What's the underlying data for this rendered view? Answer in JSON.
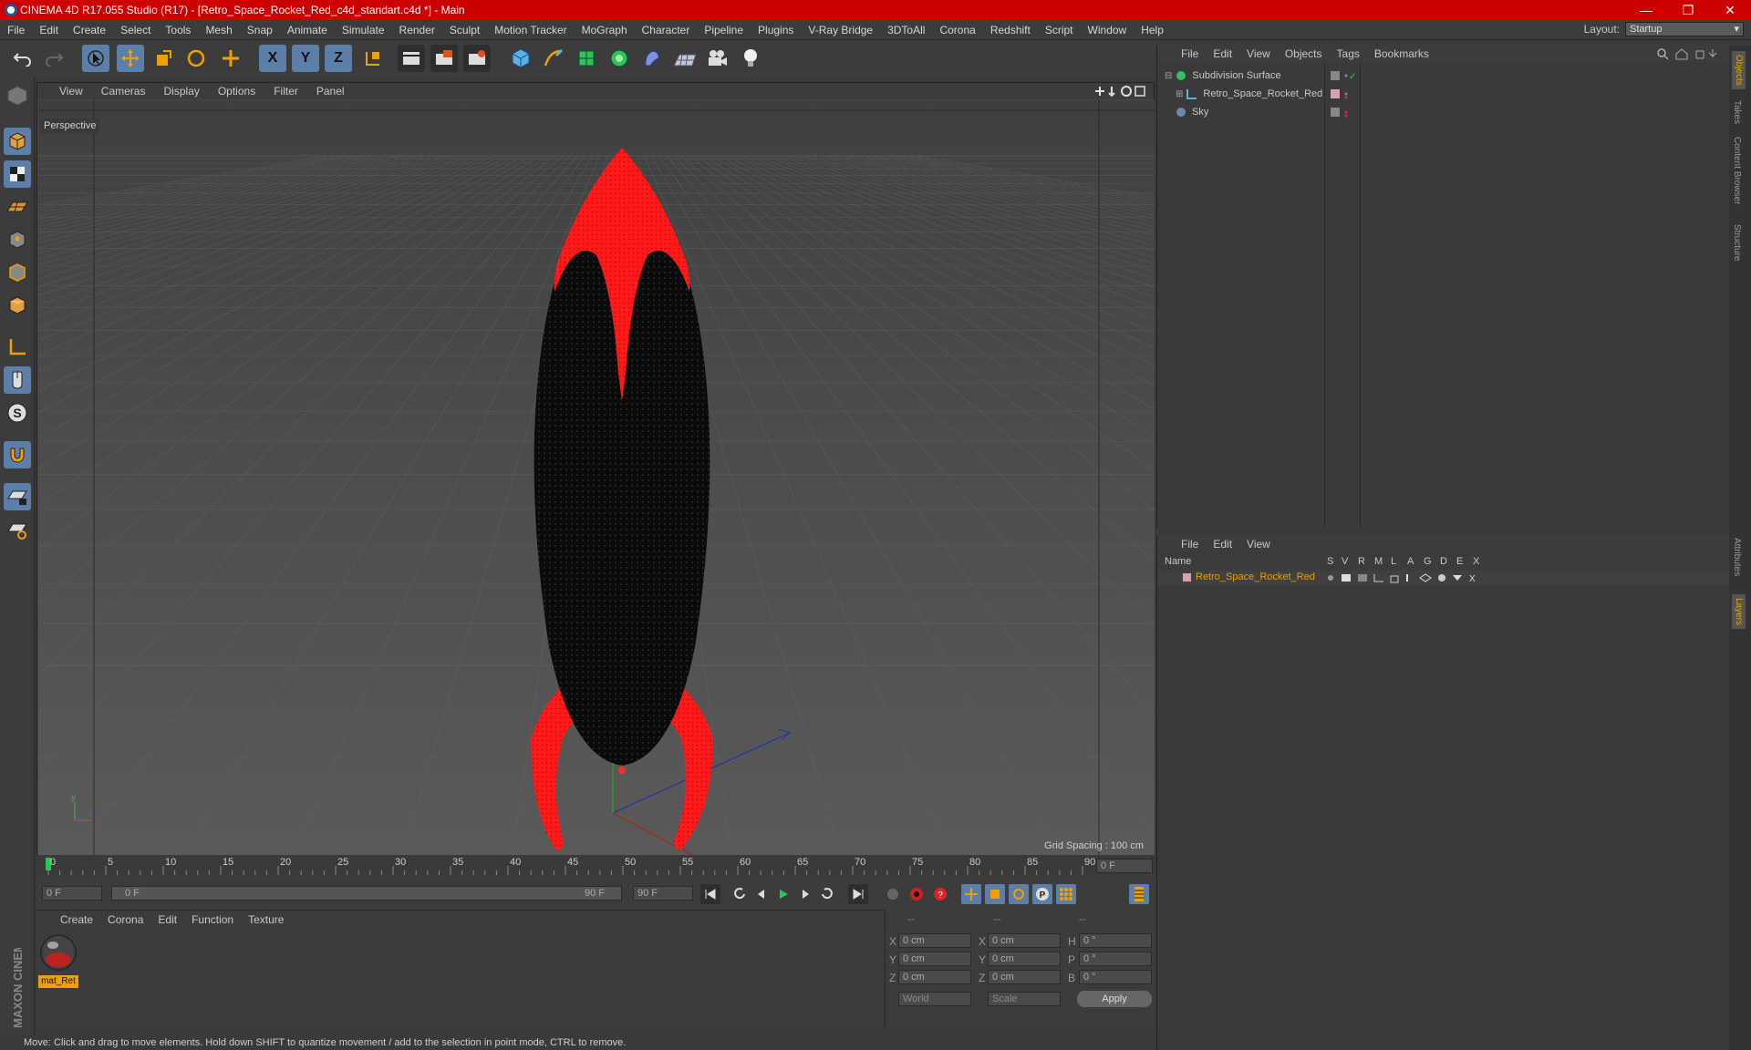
{
  "window": {
    "title": "CINEMA 4D R17.055 Studio (R17) - [Retro_Space_Rocket_Red_c4d_standart.c4d *] - Main",
    "minimize": "—",
    "maximize": "❐",
    "close": "✕"
  },
  "menu": [
    "File",
    "Edit",
    "Create",
    "Select",
    "Tools",
    "Mesh",
    "Snap",
    "Animate",
    "Simulate",
    "Render",
    "Sculpt",
    "Motion Tracker",
    "MoGraph",
    "Character",
    "Pipeline",
    "Plugins",
    "V-Ray Bridge",
    "3DToAll",
    "Corona",
    "Redshift",
    "Script",
    "Window",
    "Help"
  ],
  "layout": {
    "label": "Layout:",
    "value": "Startup"
  },
  "toolbar": {
    "x": "X",
    "y": "Y",
    "z": "Z"
  },
  "viewport": {
    "menu": [
      "View",
      "Cameras",
      "Display",
      "Options",
      "Filter",
      "Panel"
    ],
    "name": "Perspective",
    "grid_spacing": "Grid Spacing : 100 cm"
  },
  "timeline": {
    "ticks": [
      "0",
      "5",
      "10",
      "15",
      "20",
      "25",
      "30",
      "35",
      "40",
      "45",
      "50",
      "55",
      "60",
      "65",
      "70",
      "75",
      "80",
      "85",
      "90"
    ],
    "current_frame": "0 F"
  },
  "transport": {
    "start": "0 F",
    "range_start": "0 F",
    "range_end": "90 F",
    "end": "90 F"
  },
  "material_manager": {
    "menu": [
      "Create",
      "Corona",
      "Edit",
      "Function",
      "Texture"
    ],
    "material_name": "mat_Ret"
  },
  "coordinates": {
    "header": [
      "--",
      "--",
      "--"
    ],
    "rows": [
      {
        "a": "X",
        "av": "0 cm",
        "b": "X",
        "bv": "0 cm",
        "c": "H",
        "cv": "0 °"
      },
      {
        "a": "Y",
        "av": "0 cm",
        "b": "Y",
        "bv": "0 cm",
        "c": "P",
        "cv": "0 °"
      },
      {
        "a": "Z",
        "av": "0 cm",
        "b": "Z",
        "bv": "0 cm",
        "c": "B",
        "cv": "0 °"
      }
    ],
    "world": "World",
    "scale": "Scale",
    "apply": "Apply"
  },
  "status": "Move: Click and drag to move elements. Hold down SHIFT to quantize movement / add to the selection in point mode, CTRL to remove.",
  "object_manager": {
    "menu": [
      "File",
      "Edit",
      "View",
      "Objects",
      "Tags",
      "Bookmarks"
    ],
    "objects": [
      "Subdivision Surface",
      "Retro_Space_Rocket_Red",
      "Sky"
    ]
  },
  "layer_manager": {
    "menu": [
      "File",
      "Edit",
      "View"
    ],
    "columns": [
      "Name",
      "S",
      "V",
      "R",
      "M",
      "L",
      "A",
      "G",
      "D",
      "E",
      "X"
    ],
    "layer": "Retro_Space_Rocket_Red"
  },
  "side_tabs": [
    "Objects",
    "Takes",
    "Content Browser",
    "Structure",
    "Attributes",
    "Layers"
  ],
  "brand": "MAXON CINEMA 4D",
  "colors": {
    "accent": "#cc0000",
    "highlight": "#5b7fa8",
    "layer_text": "#e8a000"
  }
}
